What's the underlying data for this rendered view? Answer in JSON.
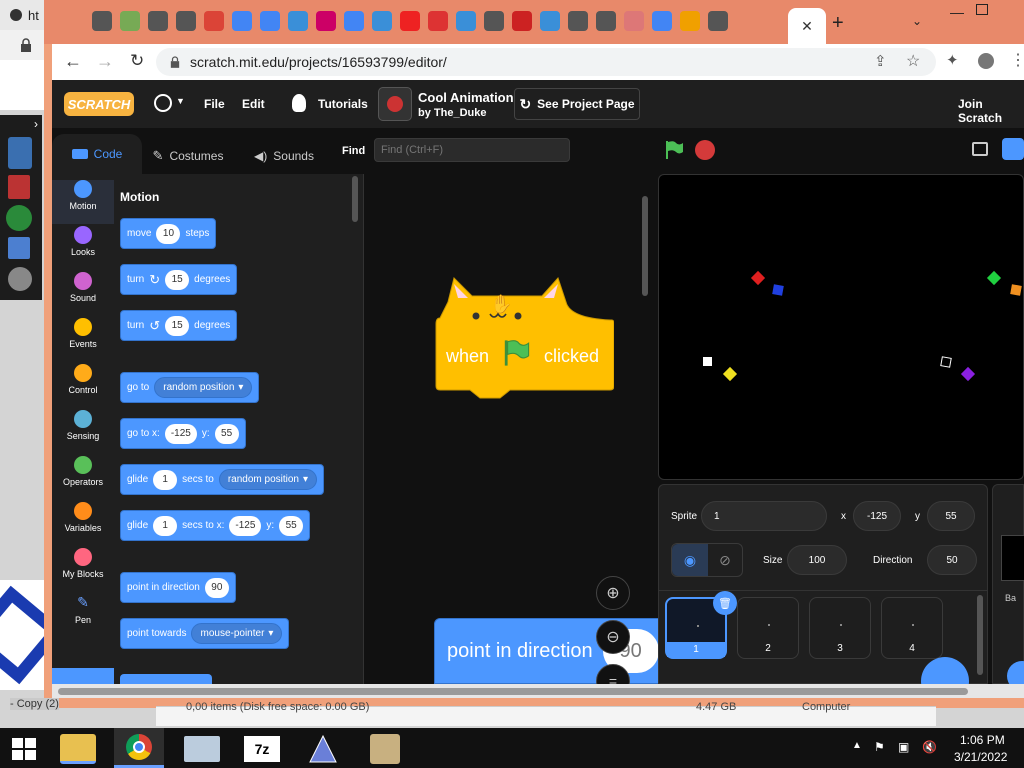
{
  "browser": {
    "left_tab_title": "ht",
    "url": "scratch.mit.edu/projects/16593799/editor/",
    "tab_icons": [
      "tab-favicon",
      "tab-favicon",
      "tab-favicon",
      "tab-favicon",
      "tab-favicon",
      "google-favicon",
      "google-favicon",
      "tab-favicon",
      "tab-favicon",
      "google-favicon",
      "tab-favicon",
      "youtube-favicon",
      "tab-favicon",
      "tab-favicon",
      "tab-favicon",
      "tab-favicon",
      "google-favicon",
      "tab-favicon",
      "tab-favicon",
      "tab-favicon",
      "tab-favicon",
      "google-favicon",
      "tab-favicon"
    ],
    "new_tab": "+",
    "close_tab": "✕"
  },
  "menu": {
    "logo": "SCRATCH",
    "file": "File",
    "edit": "Edit",
    "tutorials": "Tutorials",
    "project_title": "Cool Animation",
    "project_author": "by The_Duke",
    "see_project_page": "See Project Page",
    "join": "Join Scratch"
  },
  "tabs": {
    "code": "Code",
    "costumes": "Costumes",
    "sounds": "Sounds"
  },
  "find": {
    "label": "Find",
    "placeholder": "Find (Ctrl+F)"
  },
  "categories": [
    {
      "label": "Motion",
      "color": "#4c97ff"
    },
    {
      "label": "Looks",
      "color": "#9966ff"
    },
    {
      "label": "Sound",
      "color": "#cf63cf"
    },
    {
      "label": "Events",
      "color": "#ffbf00"
    },
    {
      "label": "Control",
      "color": "#ffab19"
    },
    {
      "label": "Sensing",
      "color": "#5cb1d6"
    },
    {
      "label": "Operators",
      "color": "#59c059"
    },
    {
      "label": "Variables",
      "color": "#ff8c1a"
    },
    {
      "label": "My Blocks",
      "color": "#ff6680"
    },
    {
      "label": "Pen",
      "color": "#0fbd8c"
    }
  ],
  "palette": {
    "heading": "Motion",
    "move": {
      "a": "move",
      "val": "10",
      "b": "steps"
    },
    "turn_right": {
      "a": "turn",
      "val": "15",
      "b": "degrees"
    },
    "turn_left": {
      "a": "turn",
      "val": "15",
      "b": "degrees"
    },
    "goto": {
      "a": "go to",
      "dropdown": "random position"
    },
    "goto_xy": {
      "a": "go to x:",
      "x": "-125",
      "ylabel": "y:",
      "y": "55"
    },
    "glide": {
      "a": "glide",
      "val": "1",
      "b": "secs to",
      "dropdown": "random position"
    },
    "glide_xy": {
      "a": "glide",
      "val": "1",
      "b": "secs to x:",
      "x": "-125",
      "ylabel": "y:",
      "y": "55"
    },
    "point_dir": {
      "a": "point in direction",
      "val": "90"
    },
    "point_towards": {
      "a": "point towards",
      "dropdown": "mouse-pointer"
    }
  },
  "script": {
    "hat_when": "when",
    "hat_clicked": "clicked",
    "point_dir_label": "point in direction",
    "point_dir_val": "90"
  },
  "sprite_info": {
    "sprite_label": "Sprite",
    "sprite_name": "1",
    "x_label": "x",
    "x": "-125",
    "y_label": "y",
    "y": "55",
    "size_label": "Size",
    "size": "100",
    "direction_label": "Direction",
    "direction": "50"
  },
  "sprites": [
    "1",
    "2",
    "3",
    "4"
  ],
  "stage_side_label": "Ba",
  "taskbar": {
    "time": "1:06 PM",
    "date": "3/21/2022"
  },
  "background_window": {
    "status": "0,00 items (Disk free space: 0.00 GB)",
    "col1": "4.47 GB",
    "col2": "Computer",
    "copy": "- Copy (2)"
  }
}
